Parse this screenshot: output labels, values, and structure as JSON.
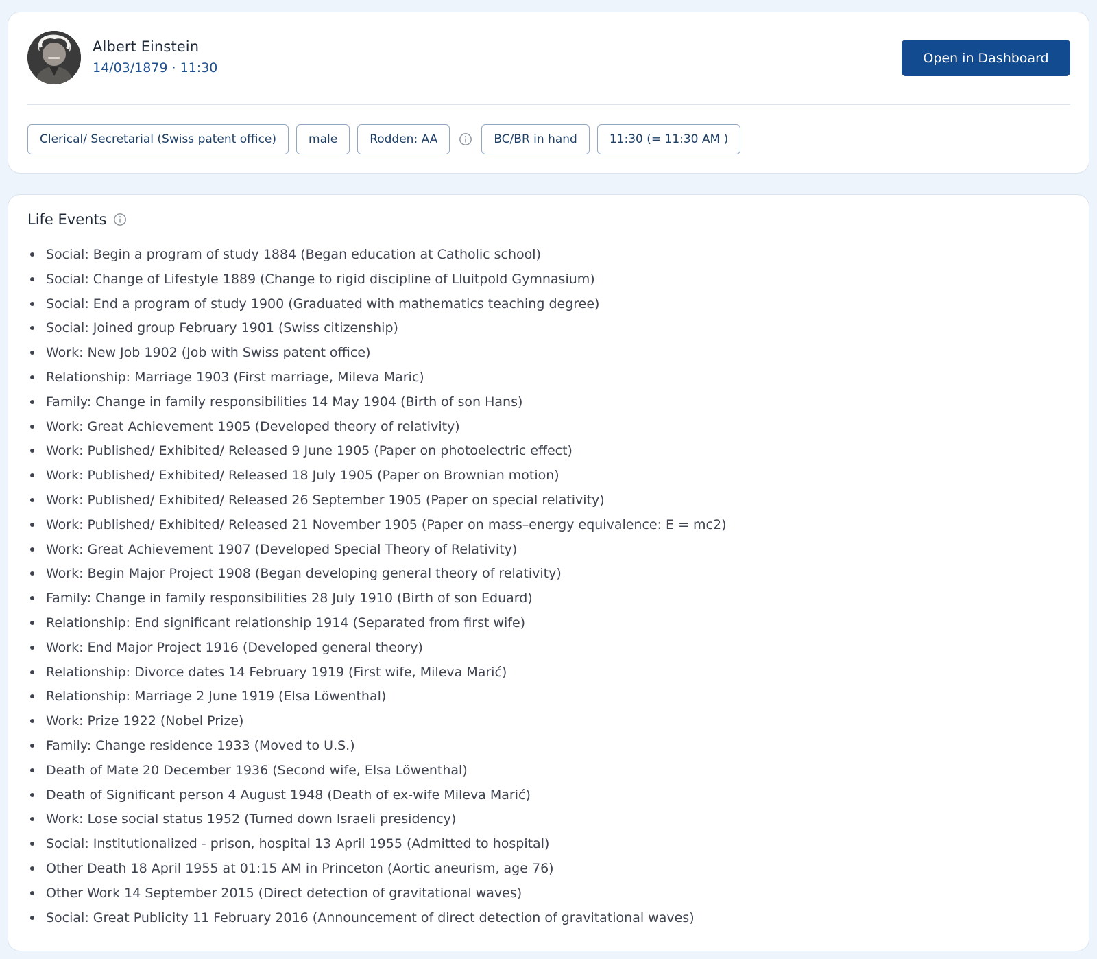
{
  "profile": {
    "name": "Albert Einstein",
    "datetime": "14/03/1879 · 11:30",
    "avatar_icon": "portrait-photo",
    "dashboard_button": "Open in Dashboard"
  },
  "tags": {
    "occupation": "Clerical/ Secretarial (Swiss patent office)",
    "gender": "male",
    "rodden": "Rodden: AA",
    "rodden_info_icon": "info-icon",
    "source": "BC/BR in hand",
    "time": "11:30 (= 11:30 AM )"
  },
  "life_events": {
    "title": "Life Events",
    "info_icon": "info-icon",
    "items": [
      "Social: Begin a program of study 1884 (Began education at Catholic school)",
      "Social: Change of Lifestyle 1889 (Change to rigid discipline of Lluitpold Gymnasium)",
      "Social: End a program of study 1900 (Graduated with mathematics teaching degree)",
      "Social: Joined group February 1901 (Swiss citizenship)",
      "Work: New Job 1902 (Job with Swiss patent office)",
      "Relationship: Marriage 1903 (First marriage, Mileva Maric)",
      "Family: Change in family responsibilities 14 May 1904 (Birth of son Hans)",
      "Work: Great Achievement 1905 (Developed theory of relativity)",
      "Work: Published/ Exhibited/ Released 9 June 1905 (Paper on photoelectric effect)",
      "Work: Published/ Exhibited/ Released 18 July 1905 (Paper on Brownian motion)",
      "Work: Published/ Exhibited/ Released 26 September 1905 (Paper on special relativity)",
      "Work: Published/ Exhibited/ Released 21 November 1905 (Paper on mass–energy equivalence: E = mc2)",
      "Work: Great Achievement 1907 (Developed Special Theory of Relativity)",
      "Work: Begin Major Project 1908 (Began developing general theory of relativity)",
      "Family: Change in family responsibilities 28 July 1910 (Birth of son Eduard)",
      "Relationship: End significant relationship 1914 (Separated from first wife)",
      "Work: End Major Project 1916 (Developed general theory)",
      "Relationship: Divorce dates 14 February 1919 (First wife, Mileva Marić)",
      "Relationship: Marriage 2 June 1919 (Elsa Löwenthal)",
      "Work: Prize 1922 (Nobel Prize)",
      "Family: Change residence 1933 (Moved to U.S.)",
      "Death of Mate 20 December 1936 (Second wife, Elsa Löwenthal)",
      "Death of Significant person 4 August 1948 (Death of ex-wife Mileva Marić)",
      "Work: Lose social status 1952 (Turned down Israeli presidency)",
      "Social: Institutionalized - prison, hospital 13 April 1955 (Admitted to hospital)",
      "Other Death 18 April 1955 at 01:15 AM in Princeton (Aortic aneurism, age 76)",
      "Other Work 14 September 2015 (Direct detection of gravitational waves)",
      "Social: Great Publicity 11 February 2016 (Announcement of direct detection of gravitational waves)"
    ]
  },
  "colors": {
    "page_background": "#eef4fc",
    "accent": "#124b8f",
    "date_text": "#1e4f8f",
    "tag_border": "#93a7c2"
  }
}
